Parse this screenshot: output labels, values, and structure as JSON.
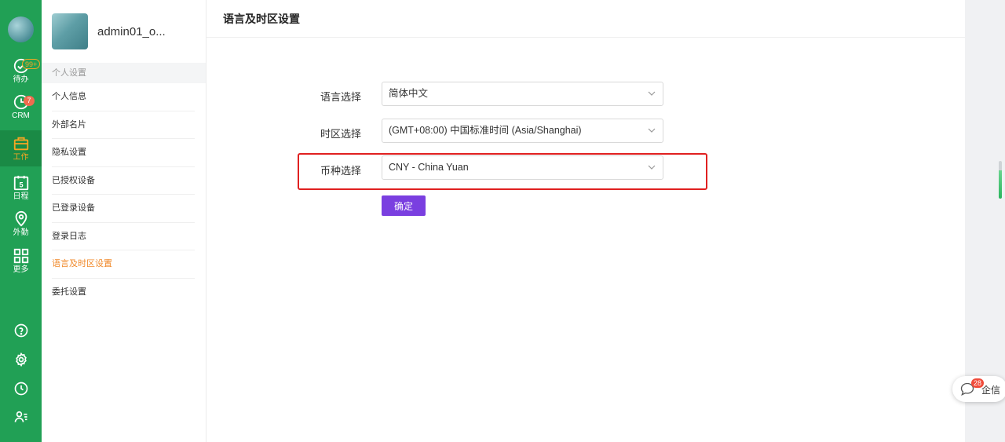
{
  "rail": {
    "items": [
      {
        "label": "待办",
        "badge": "99+"
      },
      {
        "label": "CRM",
        "badge": "7"
      },
      {
        "label": "工作"
      },
      {
        "label": "日程",
        "icon_text": "5"
      },
      {
        "label": "外勤"
      },
      {
        "label": "更多"
      }
    ]
  },
  "sidebar": {
    "user_name": "admin01_o...",
    "section_title": "个人设置",
    "items": [
      {
        "label": "个人信息"
      },
      {
        "label": "外部名片"
      },
      {
        "label": "隐私设置"
      },
      {
        "label": "已授权设备"
      },
      {
        "label": "已登录设备"
      },
      {
        "label": "登录日志"
      },
      {
        "label": "语言及时区设置"
      },
      {
        "label": "委托设置"
      }
    ]
  },
  "main": {
    "title": "语言及时区设置",
    "form": {
      "language_label": "语言选择",
      "language_value": "简体中文",
      "timezone_label": "时区选择",
      "timezone_value": "(GMT+08:00) 中国标准时间 (Asia/Shanghai)",
      "currency_label": "币种选择",
      "currency_value": "CNY - China Yuan",
      "confirm_label": "确定"
    }
  },
  "chat": {
    "badge": "28",
    "label": "企信"
  },
  "colors": {
    "rail_green": "#21a055",
    "active_orange": "#f08a2b",
    "confirm_purple": "#7a3fe0",
    "highlight_red": "#e02020"
  }
}
